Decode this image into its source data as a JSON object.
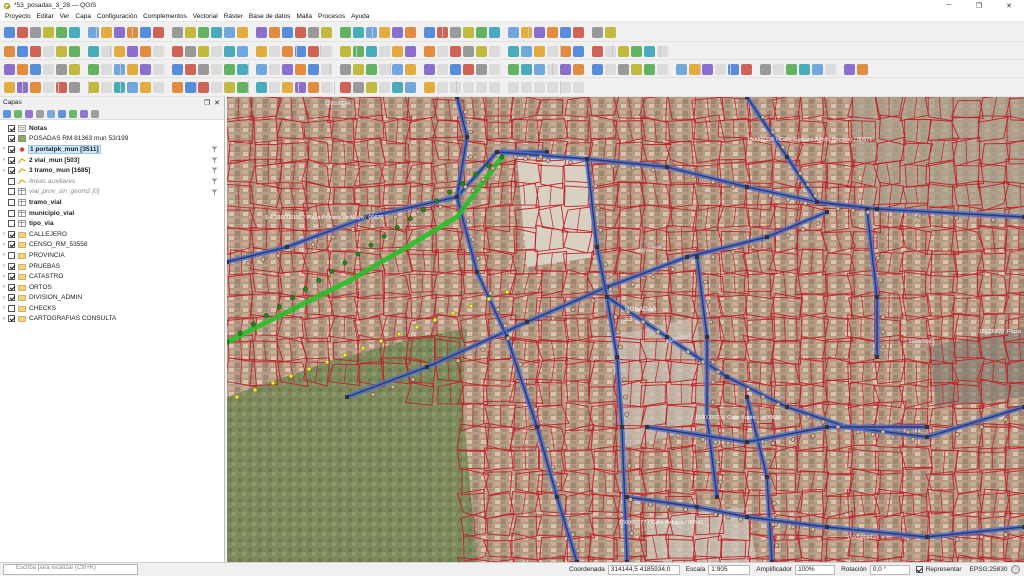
{
  "window": {
    "title": "*53_posadas_3_28 — QGIS",
    "minimize_glyph": "─",
    "maximize_glyph": "❐",
    "close_glyph": "✕"
  },
  "menu": [
    "Proyecto",
    "Editar",
    "Ver",
    "Capa",
    "Configuración",
    "Complementos",
    "Vectorial",
    "Ráster",
    "Base de datos",
    "Malla",
    "Procesos",
    "Ayuda"
  ],
  "panel": {
    "title": "Capas",
    "float_glyph": "❐",
    "close_glyph": "✕"
  },
  "layers": [
    {
      "name": "Notas",
      "checked": true,
      "expand": false,
      "style": "bold",
      "icon": "notes-icon"
    },
    {
      "name": "POSADAS RM 81363 mun 53/199",
      "checked": true,
      "expand": false,
      "style": "normal",
      "icon": "raster-icon"
    },
    {
      "name": "1 portalpk_mun [3511]",
      "checked": true,
      "expand": true,
      "style": "bold-selected",
      "icon": "point-layer-icon",
      "filter": true
    },
    {
      "name": "2 vial_mun [503]",
      "checked": true,
      "expand": true,
      "style": "bold",
      "icon": "line-layer-icon",
      "filter": true
    },
    {
      "name": "3 tramo_mun [1685]",
      "checked": true,
      "expand": true,
      "style": "bold",
      "icon": "line-layer-icon",
      "filter": true
    },
    {
      "name": "lineas auxiliares",
      "checked": false,
      "expand": false,
      "style": "italic",
      "icon": "line-layer-icon",
      "filter": true
    },
    {
      "name": "vial_prov_sin_geom2 [0]",
      "checked": false,
      "expand": false,
      "style": "italic",
      "icon": "table-icon",
      "filter": true
    },
    {
      "name": "tramo_vial",
      "checked": false,
      "expand": false,
      "style": "bold-table",
      "icon": "table-icon"
    },
    {
      "name": "municipio_vial",
      "checked": false,
      "expand": false,
      "style": "bold-table",
      "icon": "table-icon"
    },
    {
      "name": "tipo_via",
      "checked": false,
      "expand": false,
      "style": "bold-table",
      "icon": "table-icon"
    },
    {
      "name": "CALLEJERO",
      "checked": true,
      "expand": true,
      "style": "normal",
      "icon": "group-icon"
    },
    {
      "name": "CENSO_RM_53558",
      "checked": true,
      "expand": true,
      "style": "normal",
      "icon": "group-icon"
    },
    {
      "name": "PROVINCIA",
      "checked": false,
      "expand": true,
      "style": "normal",
      "icon": "group-icon"
    },
    {
      "name": "PRUEBAS",
      "checked": true,
      "expand": true,
      "style": "normal",
      "icon": "group-icon"
    },
    {
      "name": "CATASTRO",
      "checked": true,
      "expand": true,
      "style": "normal",
      "icon": "group-icon"
    },
    {
      "name": "ORTOS",
      "checked": true,
      "expand": true,
      "style": "normal",
      "icon": "group-icon"
    },
    {
      "name": "DIVISION_ADMIN",
      "checked": true,
      "expand": true,
      "style": "normal",
      "icon": "group-icon"
    },
    {
      "name": "CHECKS",
      "checked": false,
      "expand": true,
      "style": "normal",
      "icon": "group-icon"
    },
    {
      "name": "CARTOGRAFIAS CONSULTA",
      "checked": true,
      "expand": true,
      "style": "normal",
      "icon": "group-icon"
    }
  ],
  "map_labels": {
    "plaza_primero": "1-4 150000156 / Plaza Primero de Mayo / 00670",
    "calle_gustavo": "150000196 / Calle Gustavo Adolfo Becquer / 00671",
    "municipio_name": "POSADAS",
    "municipio_code": "53",
    "plaza_label": "Plaza",
    "calle_antigua": "150000077 / Calle Antigua / 00641",
    "calle_santo": "150000027 / Calle Santo ... / 00620",
    "code_a": "150000009",
    "code_b": "150000020",
    "code_c": "500000003",
    "code_d": "150000017",
    "code_e": "150000044",
    "code_f": "150000084"
  },
  "status": {
    "locator_placeholder": "Escriba para localizar (Ctrl+K)",
    "coord_label": "Coordenada",
    "coord_value": "314144,5 4185934,0",
    "scale_label": "Escala",
    "scale_value": "1:905",
    "magnifier_label": "Amplificador",
    "magnifier_value": "100%",
    "rotation_label": "Rotación",
    "rotation_value": "0,0 °",
    "render_label": "Representar",
    "render_checked": true,
    "crs": "EPSG:25830"
  },
  "colors": {
    "parcel": "#c0232a",
    "street_blue": "#4a6fd0",
    "street_dark": "#2c3a6a",
    "highlight_green": "#27c02a",
    "point_yellow": "#f2ee3a"
  }
}
